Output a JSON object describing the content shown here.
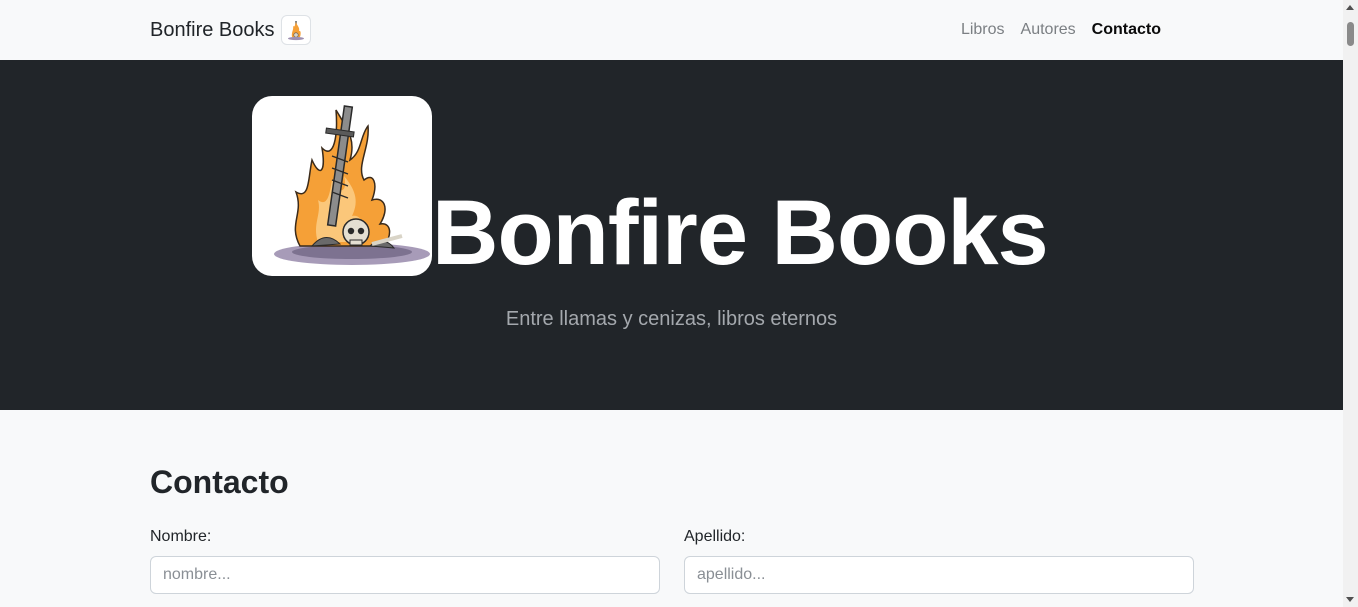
{
  "navbar": {
    "brand_text": "Bonfire Books",
    "brand_logo_icon": "bonfire-logo-icon",
    "links": [
      {
        "label": "Libros",
        "active": false
      },
      {
        "label": "Autores",
        "active": false
      },
      {
        "label": "Contacto",
        "active": true
      }
    ]
  },
  "hero": {
    "logo_icon": "bonfire-logo-icon",
    "title": "Bonfire Books",
    "subtitle": "Entre llamas y cenizas, libros eternos",
    "background": "#212529"
  },
  "contact": {
    "title": "Contacto",
    "fields": [
      {
        "label": "Nombre:",
        "placeholder": "nombre...",
        "value": ""
      },
      {
        "label": "Apellido:",
        "placeholder": "apellido...",
        "value": ""
      }
    ]
  },
  "colors": {
    "flame": "#f5a037",
    "text_dark": "#212529",
    "muted": "#7b7f83"
  }
}
